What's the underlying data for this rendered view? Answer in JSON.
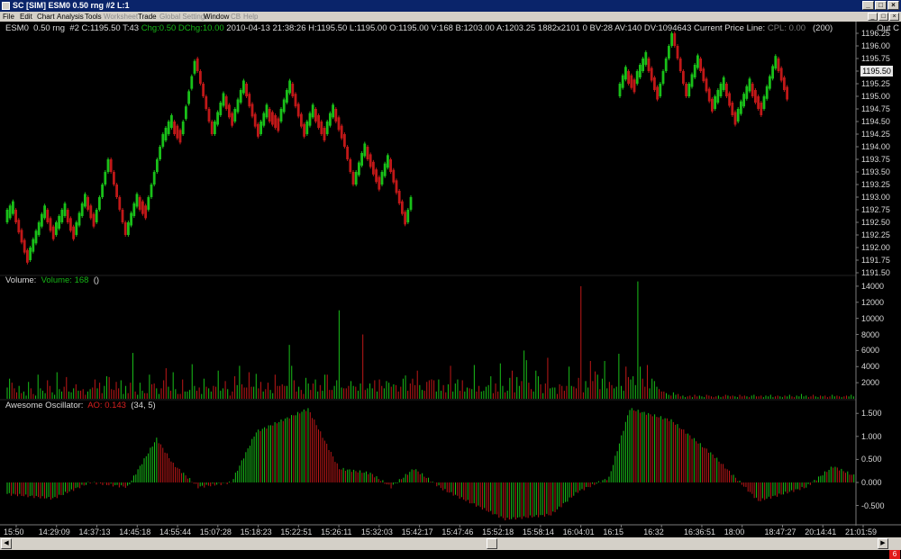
{
  "window": {
    "title": "SC [SIM] ESM0  0.50 rng  #2  L:1",
    "minimize": "_",
    "maximize": "□",
    "close": "×"
  },
  "menu": {
    "items": [
      "File",
      "Edit",
      "Chart",
      "Analysis",
      "Tools",
      "Worksheet",
      "Trade",
      "Global Settings",
      "Window",
      "CB",
      "Help"
    ],
    "disabled": [
      "Worksheet",
      "Global Settings",
      "CB",
      "Help"
    ]
  },
  "chart_header": {
    "symbol": "ESM0",
    "interval": "0.50 rng",
    "id": "#2",
    "close_tick": "C:1195.50 T:43",
    "change": "Chg:0.50 DChg:10.00",
    "datetime": "2010-04-13 21:38:26",
    "ohlc": "H:1195.50 L:1195.00 O:1195.00 V:168 B:1203.00 A:1203.25 1882x2101 0 BV:28 AV:140 DV:1094643 Current Price Line:",
    "cpl": "CPL: 0.00",
    "count": "(200)",
    "out_label": "Out C"
  },
  "current_price": "1195.50",
  "volume_label": {
    "name": "Volume:",
    "value": "Volume: 168",
    "extra": "()"
  },
  "ao_label": {
    "name": "Awesome Oscillator:",
    "value": "AO: 0.143",
    "params": "(34, 5)"
  },
  "colors": {
    "up": "#19c019",
    "down": "#c01818",
    "axis": "#7a7a7a",
    "text": "#d8d8d8"
  },
  "price_scale": [
    "1196.25",
    "1196.00",
    "1195.75",
    "1195.50",
    "1195.25",
    "1195.00",
    "1194.75",
    "1194.50",
    "1194.25",
    "1194.00",
    "1193.75",
    "1193.50",
    "1193.25",
    "1193.00",
    "1192.75",
    "1192.50",
    "1192.25",
    "1192.00",
    "1191.75",
    "1191.50"
  ],
  "volume_scale": [
    "14000",
    "12000",
    "10000",
    "8000",
    "6000",
    "4000",
    "2000"
  ],
  "ao_scale": [
    "1.500",
    "1.000",
    "0.500",
    "0.000",
    "-0.500"
  ],
  "time_axis": [
    "15:50",
    "14:29:09",
    "14:37:13",
    "14:45:18",
    "14:55:44",
    "15:07:28",
    "15:18:23",
    "15:22:51",
    "15:26:11",
    "15:32:03",
    "15:42:17",
    "15:47:46",
    "15:52:18",
    "15:58:14",
    "16:04:01",
    "16:15",
    "16:32",
    "16:36:51",
    "18:00",
    "18:47:27",
    "20:14:41",
    "21:01:59"
  ],
  "status_count": "6",
  "chart_data": {
    "type": "bar",
    "price": {
      "ylim": [
        1191.5,
        1196.25
      ],
      "segments": [
        {
          "from": 1192.5,
          "to": 1192.75,
          "steps": 3
        },
        {
          "from": 1192.75,
          "to": 1191.75,
          "steps": 5
        },
        {
          "from": 1191.75,
          "to": 1192.75,
          "steps": 6
        },
        {
          "from": 1192.75,
          "to": 1192.25,
          "steps": 3
        },
        {
          "from": 1192.25,
          "to": 1192.75,
          "steps": 4
        },
        {
          "from": 1192.75,
          "to": 1192.25,
          "steps": 3
        },
        {
          "from": 1192.25,
          "to": 1193.0,
          "steps": 4
        },
        {
          "from": 1193.0,
          "to": 1192.5,
          "steps": 3
        },
        {
          "from": 1192.5,
          "to": 1193.75,
          "steps": 5
        },
        {
          "from": 1193.75,
          "to": 1192.25,
          "steps": 6
        },
        {
          "from": 1192.25,
          "to": 1193.0,
          "steps": 4
        },
        {
          "from": 1193.0,
          "to": 1192.75,
          "steps": 3
        },
        {
          "from": 1192.75,
          "to": 1194.0,
          "steps": 5
        },
        {
          "from": 1194.0,
          "to": 1194.5,
          "steps": 4
        },
        {
          "from": 1194.5,
          "to": 1194.25,
          "steps": 3
        },
        {
          "from": 1194.25,
          "to": 1195.75,
          "steps": 5
        },
        {
          "from": 1195.75,
          "to": 1194.25,
          "steps": 6
        },
        {
          "from": 1194.25,
          "to": 1195.0,
          "steps": 4
        },
        {
          "from": 1195.0,
          "to": 1194.5,
          "steps": 3
        },
        {
          "from": 1194.5,
          "to": 1195.25,
          "steps": 4
        },
        {
          "from": 1195.25,
          "to": 1194.25,
          "steps": 5
        },
        {
          "from": 1194.25,
          "to": 1194.75,
          "steps": 3
        },
        {
          "from": 1194.75,
          "to": 1194.5,
          "steps": 4
        },
        {
          "from": 1194.5,
          "to": 1195.25,
          "steps": 4
        },
        {
          "from": 1195.25,
          "to": 1194.25,
          "steps": 5
        },
        {
          "from": 1194.25,
          "to": 1194.75,
          "steps": 3
        },
        {
          "from": 1194.75,
          "to": 1194.25,
          "steps": 4
        },
        {
          "from": 1194.25,
          "to": 1194.75,
          "steps": 3
        },
        {
          "from": 1194.75,
          "to": 1194.25,
          "steps": 3
        },
        {
          "from": 1194.25,
          "to": 1193.25,
          "steps": 4
        },
        {
          "from": 1193.25,
          "to": 1194.0,
          "steps": 4
        },
        {
          "from": 1194.0,
          "to": 1193.25,
          "steps": 5
        },
        {
          "from": 1193.25,
          "to": 1193.75,
          "steps": 3
        },
        {
          "from": 1193.75,
          "to": 1192.5,
          "steps": 6
        },
        {
          "from": 1192.5,
          "to": 1193.0,
          "steps": 2
        },
        {
          "from": 1195.0,
          "to": 1195.5,
          "steps": 3
        },
        {
          "from": 1195.5,
          "to": 1195.25,
          "steps": 3
        },
        {
          "from": 1195.25,
          "to": 1195.75,
          "steps": 4
        },
        {
          "from": 1195.75,
          "to": 1195.0,
          "steps": 4
        },
        {
          "from": 1195.0,
          "to": 1196.25,
          "steps": 5
        },
        {
          "from": 1196.25,
          "to": 1195.0,
          "steps": 5
        },
        {
          "from": 1195.0,
          "to": 1195.75,
          "steps": 4
        },
        {
          "from": 1195.75,
          "to": 1194.75,
          "steps": 5
        },
        {
          "from": 1194.75,
          "to": 1195.25,
          "steps": 4
        },
        {
          "from": 1195.25,
          "to": 1194.5,
          "steps": 4
        },
        {
          "from": 1194.5,
          "to": 1195.25,
          "steps": 5
        },
        {
          "from": 1195.25,
          "to": 1194.75,
          "steps": 4
        },
        {
          "from": 1194.75,
          "to": 1195.75,
          "steps": 5
        },
        {
          "from": 1195.75,
          "to": 1195.0,
          "steps": 4
        }
      ]
    },
    "volume": {
      "ylim": [
        0,
        15000
      ],
      "values": [
        1400,
        2500,
        2000,
        1300,
        800,
        1600,
        700,
        900,
        400,
        2100,
        1300,
        600,
        400,
        3000,
        1300,
        1000,
        700,
        2300,
        1600,
        800,
        500,
        3300,
        1200,
        900,
        1500,
        2700,
        900,
        800,
        1300,
        1800,
        1000,
        1000,
        1200,
        500,
        900,
        1200,
        1400,
        2400,
        1300,
        2000,
        700,
        1600,
        2800,
        2700,
        1200,
        1100,
        2100,
        1300,
        2300,
        600,
        1600,
        700,
        2000,
        5700,
        900,
        500,
        2000,
        1000,
        700,
        700,
        3000,
        1800,
        1900,
        1300,
        600,
        1300,
        2300,
        3800,
        1500,
        1000,
        3300,
        1200,
        600,
        600,
        2400,
        900,
        900,
        1100,
        4300,
        1600,
        1000,
        1400,
        600,
        2500,
        1500,
        1300,
        900,
        1600,
        1500,
        3500,
        1000,
        1300,
        2200,
        1200,
        400,
        900,
        2800,
        1700,
        4100,
        1800,
        1400,
        1400,
        3300,
        1500,
        1500,
        3100,
        1300,
        2100,
        900,
        1200,
        2000,
        1100,
        700,
        3000,
        1600,
        1600,
        1800,
        1600,
        1600,
        6700,
        4100,
        2300,
        900,
        1500,
        1100,
        600,
        2600,
        1900,
        1100,
        1900,
        2400,
        900,
        1700,
        1000,
        3000,
        3000,
        1100,
        1100,
        1600,
        2300,
        11000,
        1400,
        1300,
        1300,
        1600,
        2200,
        1600,
        1500,
        1000,
        1900,
        8000,
        1100,
        1300,
        1900,
        1300,
        2300,
        900,
        2400,
        1600,
        1300,
        2200,
        2000,
        1500,
        1800,
        1700,
        900,
        1500,
        2500,
        2900,
        1000,
        1900,
        2500,
        1700,
        3500,
        1700,
        1100,
        1000,
        2100,
        2300,
        2400,
        2300,
        900,
        2400,
        1000,
        1700,
        800,
        1800,
        4100,
        900,
        1900,
        2400,
        1000,
        2300,
        900,
        1400,
        1300,
        1200,
        4200,
        900,
        1600,
        900,
        1000,
        1500,
        1700,
        2800,
        700,
        1900,
        900,
        4400,
        1600,
        800,
        1000,
        2600,
        3500,
        800,
        2700,
        1600,
        2200,
        6000,
        4800,
        2000,
        1200,
        900,
        3500,
        2800,
        1800,
        700,
        1900,
        5100,
        1300,
        1400,
        1400,
        600,
        1800,
        1600,
        1000,
        1600,
        4000,
        1600,
        1500,
        1300,
        2600,
        14000,
        800,
        2200,
        1400,
        4700,
        2200,
        3400,
        3000,
        1200,
        2500,
        4700,
        1300,
        2100,
        1700,
        1300,
        1500,
        5600,
        1600,
        1000,
        4000,
        2700,
        2400,
        2800,
        1700,
        14600,
        4000,
        2500,
        1500,
        4200,
        1300,
        2500,
        2200,
        1500,
        1200,
        900,
        900,
        700,
        500,
        400,
        800,
        500,
        600,
        300,
        400,
        200,
        300,
        400,
        200,
        500,
        300,
        400,
        300,
        200,
        500,
        400,
        300,
        200,
        300,
        400,
        200,
        300,
        500,
        400,
        300,
        400,
        300,
        200,
        500,
        300,
        400,
        300,
        200,
        400,
        500,
        300,
        300,
        400,
        200,
        400,
        300,
        500,
        200,
        300,
        400,
        300,
        200,
        400,
        300,
        500,
        300,
        200,
        400,
        300,
        600,
        300,
        400,
        200,
        300,
        500,
        300,
        200,
        400,
        300,
        400,
        200,
        300,
        500,
        300,
        400,
        300,
        200,
        300,
        400,
        300,
        500,
        300
      ]
    },
    "ao": {
      "ylim": [
        -0.9,
        1.7
      ],
      "keys": [
        {
          "i": 0,
          "v": -0.25
        },
        {
          "i": 22,
          "v": -0.35
        },
        {
          "i": 40,
          "v": 0.0
        },
        {
          "i": 58,
          "v": -0.1
        },
        {
          "i": 72,
          "v": 0.95
        },
        {
          "i": 80,
          "v": 0.4
        },
        {
          "i": 92,
          "v": -0.1
        },
        {
          "i": 108,
          "v": 0.0
        },
        {
          "i": 120,
          "v": 1.1
        },
        {
          "i": 145,
          "v": 1.6
        },
        {
          "i": 160,
          "v": 0.3
        },
        {
          "i": 175,
          "v": 0.2
        },
        {
          "i": 185,
          "v": -0.1
        },
        {
          "i": 196,
          "v": 0.3
        },
        {
          "i": 210,
          "v": -0.15
        },
        {
          "i": 240,
          "v": -0.8
        },
        {
          "i": 262,
          "v": -0.7
        },
        {
          "i": 275,
          "v": -0.2
        },
        {
          "i": 290,
          "v": 0.1
        },
        {
          "i": 300,
          "v": 1.6
        },
        {
          "i": 320,
          "v": 1.35
        },
        {
          "i": 340,
          "v": 0.6
        },
        {
          "i": 362,
          "v": -0.4
        },
        {
          "i": 385,
          "v": -0.1
        },
        {
          "i": 398,
          "v": 0.35
        },
        {
          "i": 408,
          "v": 0.15
        }
      ]
    }
  }
}
